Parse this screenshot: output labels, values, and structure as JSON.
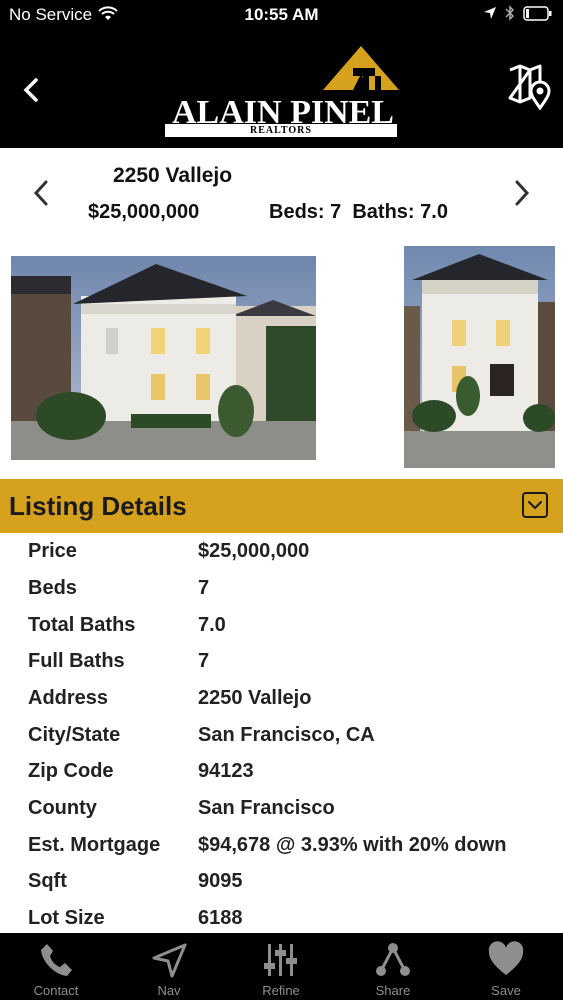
{
  "status": {
    "carrier": "No Service",
    "time": "10:55 AM"
  },
  "header": {
    "logo_text": "ALAIN PINEL",
    "logo_sub": "REALTORS"
  },
  "summary": {
    "address": "2250 Vallejo",
    "price": "$25,000,000",
    "beds_baths": "Beds: 7  Baths: 7.0"
  },
  "section": {
    "title": "Listing Details"
  },
  "details": [
    {
      "label": "Price",
      "value": "$25,000,000"
    },
    {
      "label": "Beds",
      "value": "7"
    },
    {
      "label": "Total Baths",
      "value": "7.0"
    },
    {
      "label": "Full Baths",
      "value": "7"
    },
    {
      "label": "Address",
      "value": "2250 Vallejo"
    },
    {
      "label": "City/State",
      "value": "San Francisco, CA"
    },
    {
      "label": "Zip Code",
      "value": "94123"
    },
    {
      "label": "County",
      "value": "San Francisco"
    },
    {
      "label": "Est. Mortgage",
      "value": "$94,678 @ 3.93% with 20% down"
    },
    {
      "label": "Sqft",
      "value": "9095"
    },
    {
      "label": "Lot Size",
      "value": "6188"
    }
  ],
  "tabs": [
    {
      "label": "Contact",
      "icon": "phone-icon"
    },
    {
      "label": "Nav",
      "icon": "navigation-icon"
    },
    {
      "label": "Refine",
      "icon": "sliders-icon"
    },
    {
      "label": "Share",
      "icon": "share-icon"
    },
    {
      "label": "Save",
      "icon": "heart-icon"
    }
  ],
  "colors": {
    "accent": "#d6a21e",
    "header": "#000000",
    "tab_inactive": "#8e8e8e"
  }
}
